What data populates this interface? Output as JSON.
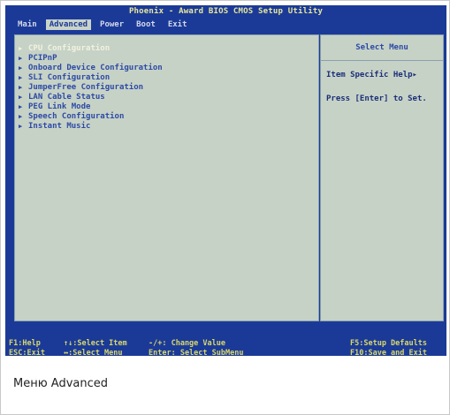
{
  "bios": {
    "title": "Phoenix - Award BIOS CMOS Setup Utility",
    "menus": [
      {
        "label": "Main",
        "active": false
      },
      {
        "label": "Advanced",
        "active": true
      },
      {
        "label": "Power",
        "active": false
      },
      {
        "label": "Boot",
        "active": false
      },
      {
        "label": "Exit",
        "active": false
      }
    ],
    "options": [
      {
        "label": "CPU Configuration",
        "selected": true
      },
      {
        "label": "PCIPnP",
        "selected": false
      },
      {
        "label": "Onboard Device Configuration",
        "selected": false
      },
      {
        "label": "SLI Configuration",
        "selected": false
      },
      {
        "label": "JumperFree Configuration",
        "selected": false
      },
      {
        "label": "LAN Cable Status",
        "selected": false
      },
      {
        "label": "PEG Link Mode",
        "selected": false
      },
      {
        "label": "Speech Configuration",
        "selected": false
      },
      {
        "label": "Instant Music",
        "selected": false
      }
    ],
    "help": {
      "title": "Select Menu",
      "line1": "Item Specific Help▸",
      "line2": "Press [Enter] to Set."
    },
    "status": {
      "f1": "F1:Help",
      "esc": "ESC:Exit",
      "select_item": "↑↓:Select Item",
      "select_menu": "↔:Select Menu",
      "change_value": "-/+: Change Value",
      "select_submenu": "Enter: Select SubMenu",
      "defaults": "F5:Setup Defaults",
      "save_exit": "F10:Save and Exit"
    }
  },
  "caption": "Меню Advanced"
}
